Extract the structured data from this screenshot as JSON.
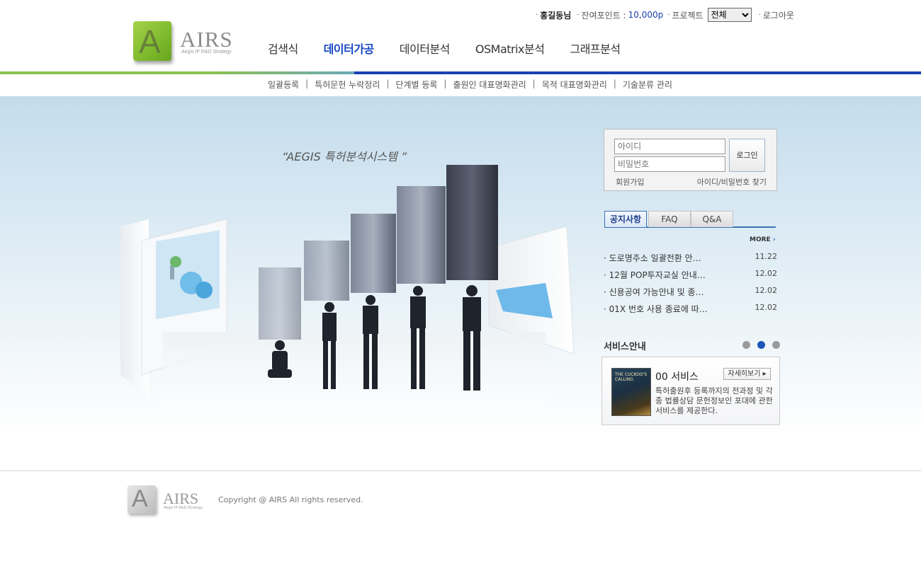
{
  "brand": {
    "logo_letter": "A",
    "logo_text": "AIRS",
    "logo_sub": "Aegis IP R&D Strategy",
    "accent_green": "#8cc152",
    "accent_blue": "#1c3fb5"
  },
  "util": {
    "user": "홍길동님",
    "points_label": "잔여포인트 :",
    "points_value": "10,000p",
    "project_label": "프로젝트",
    "project_selected": "전체",
    "logout": "로그아웃"
  },
  "gnb": [
    {
      "label": "검색식",
      "active": false
    },
    {
      "label": "데이터가공",
      "active": true
    },
    {
      "label": "데이터분석",
      "active": false
    },
    {
      "label": "OSMatrix분석",
      "active": false
    },
    {
      "label": "그래프분석",
      "active": false
    }
  ],
  "snb": [
    "일괄등록",
    "특허문헌 누락정리",
    "단계별 등록",
    "출원인 대표명화관리",
    "목적 대표명화관리",
    "기술분류 관리"
  ],
  "hero": {
    "caption": "“AEGIS 특허분석시스템 ”"
  },
  "login": {
    "id_placeholder": "아이디",
    "pw_placeholder": "비밀번호",
    "button": "로그인",
    "join": "회원가입",
    "find": "아이디/비밀번호 찾기"
  },
  "board": {
    "tabs": [
      "공지사항",
      "FAQ",
      "Q&A"
    ],
    "more": "MORE",
    "items": [
      {
        "title": "도로명주소 일괄전환 안…",
        "date": "11.22"
      },
      {
        "title": "12월 POP투자교실 안내…",
        "date": "12.02"
      },
      {
        "title": "신용공여 가능안내 및 종…",
        "date": "12.02"
      },
      {
        "title": "01X 번호 사용 종료에 따…",
        "date": "12.02"
      }
    ]
  },
  "service": {
    "title": "서비스안내",
    "name": "00 서비스",
    "detail": "자세히보기",
    "desc": "특허출원후 등록까지의 전과정 및 각종 법률상담 문헌정보인 포대에 관한 서비스를 제공한다.",
    "book_text": "THE CUCKOO'S CALLING"
  },
  "footer": {
    "copyright": "Copyright @ AIRS All rights reserved."
  }
}
